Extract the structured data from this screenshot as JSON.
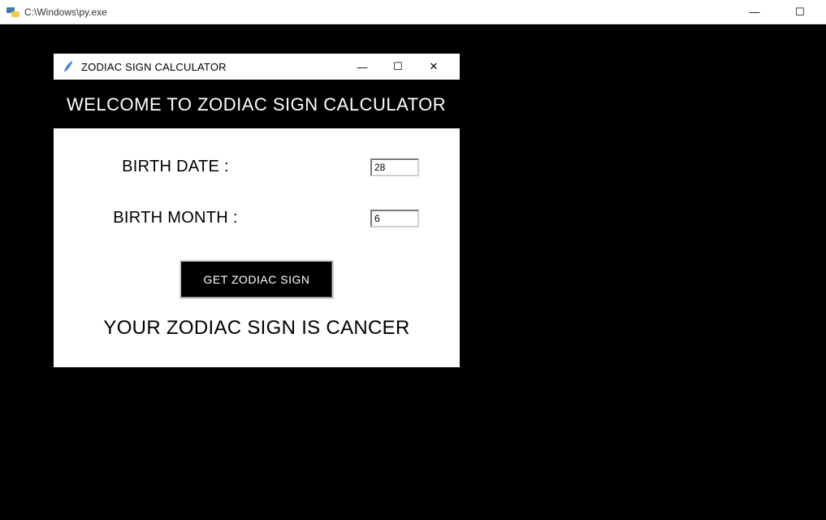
{
  "outer_window": {
    "title": "C:\\Windows\\py.exe",
    "controls": {
      "minimize": "—",
      "maximize": "☐",
      "close": "✕"
    }
  },
  "inner_window": {
    "title": "ZODIAC SIGN CALCULATOR",
    "controls": {
      "minimize": "—",
      "maximize": "☐",
      "close": "✕"
    }
  },
  "banner": "WELCOME TO ZODIAC SIGN CALCULATOR",
  "form": {
    "date_label": "BIRTH DATE :",
    "date_value": "28",
    "month_label": "BIRTH MONTH :",
    "month_value": "6"
  },
  "button_label": "GET ZODIAC SIGN",
  "result": "YOUR ZODIAC SIGN IS CANCER"
}
